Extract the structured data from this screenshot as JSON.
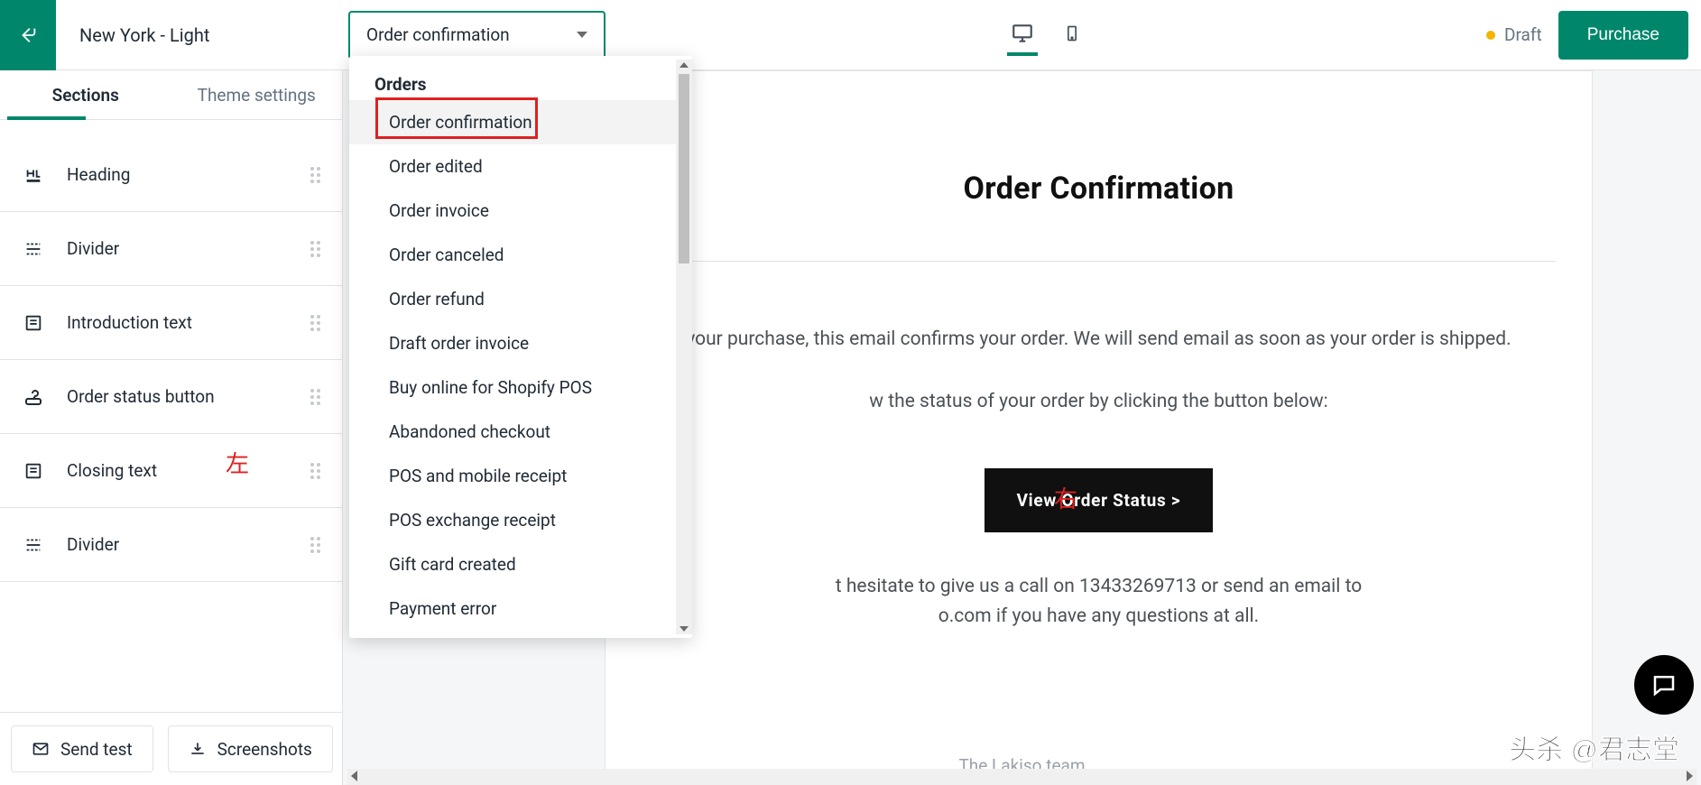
{
  "topbar": {
    "theme_name": "New York - Light",
    "select_value": "Order confirmation",
    "draft_label": "Draft",
    "purchase_label": "Purchase"
  },
  "sidebar": {
    "tabs": {
      "sections": "Sections",
      "theme_settings": "Theme settings"
    },
    "items": [
      {
        "icon": "heading-icon",
        "label": "Heading"
      },
      {
        "icon": "divider-icon",
        "label": "Divider"
      },
      {
        "icon": "text-icon",
        "label": "Introduction text"
      },
      {
        "icon": "status-icon",
        "label": "Order status button"
      },
      {
        "icon": "text-icon",
        "label": "Closing text"
      },
      {
        "icon": "divider-icon",
        "label": "Divider"
      }
    ],
    "footer": {
      "send_test": "Send test",
      "screenshots": "Screenshots"
    }
  },
  "dropdown": {
    "group_label": "Orders",
    "items": [
      "Order confirmation",
      "Order edited",
      "Order invoice",
      "Order canceled",
      "Order refund",
      "Draft order invoice",
      "Buy online for Shopify POS",
      "Abandoned checkout",
      "POS and mobile receipt",
      "POS exchange receipt",
      "Gift card created",
      "Payment error"
    ]
  },
  "preview": {
    "title": "Order Confirmation",
    "p1": "your purchase, this email confirms your order. We will send email as soon as your order is shipped.",
    "p2": "w the status of your order by clicking the button below:",
    "cta": "View Order Status >",
    "p3a": "t hesitate to give us a call on 13433269713 or send an email to",
    "p3b": "o.com if you have any questions at all.",
    "team": "The Lakiso team"
  },
  "annotations": {
    "left": "左",
    "right": "右"
  },
  "watermark": "头杀 @君志堂"
}
